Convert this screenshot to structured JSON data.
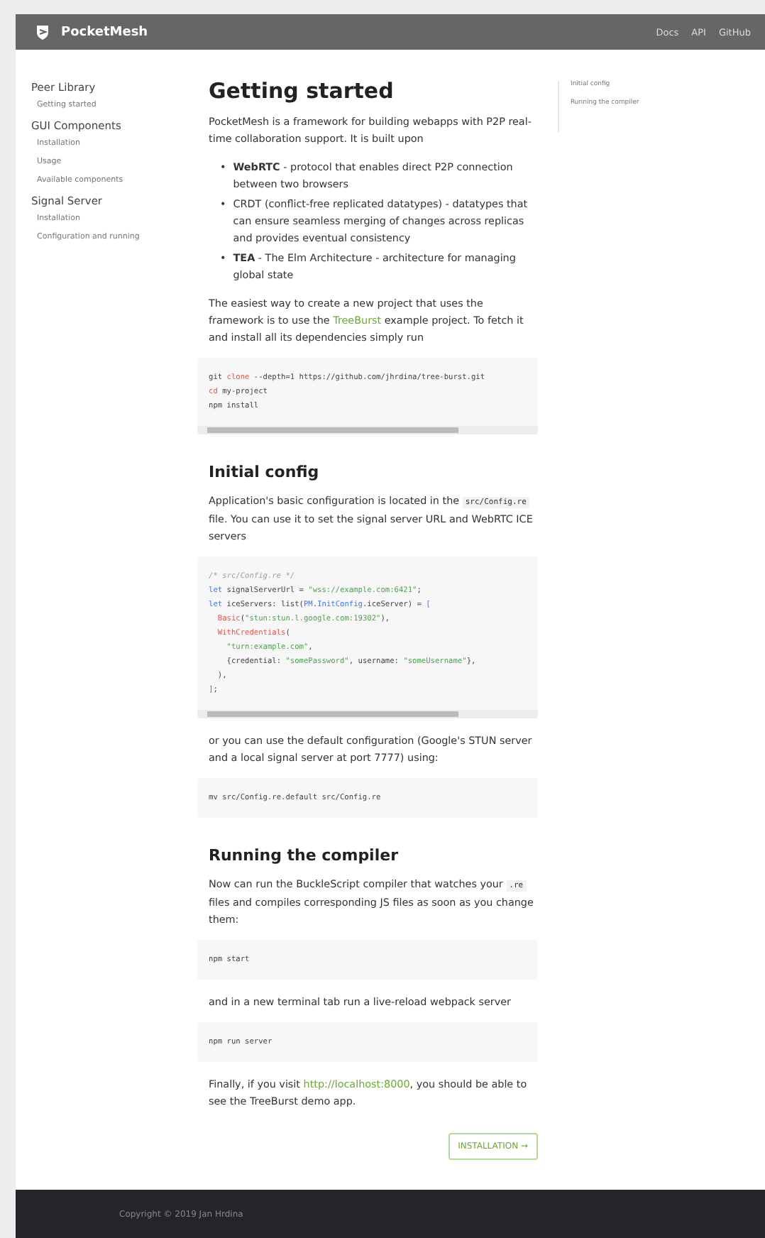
{
  "header": {
    "brand": "PocketMesh",
    "links": [
      "Docs",
      "API",
      "GitHub"
    ]
  },
  "sidebar": {
    "sections": [
      {
        "title": "Peer Library",
        "items": [
          "Getting started"
        ]
      },
      {
        "title": "GUI Components",
        "items": [
          "Installation",
          "Usage",
          "Available components"
        ]
      },
      {
        "title": "Signal Server",
        "items": [
          "Installation",
          "Configuration and running"
        ]
      }
    ]
  },
  "toc": [
    "Initial config",
    "Running the compiler"
  ],
  "content": [
    {
      "kind": "h1",
      "text": "Getting started"
    },
    {
      "kind": "p",
      "parts": [
        {
          "kind": "text",
          "text": "PocketMesh is a framework for building webapps with P2P real-time collaboration support. It is built upon"
        }
      ]
    },
    {
      "kind": "ul",
      "items": [
        {
          "marker": "•",
          "term": "WebRTC",
          "bold": true,
          "text": " - protocol that enables direct P2P connection between two browsers"
        },
        {
          "marker": "•",
          "term": "CRDT",
          "bold": false,
          "text": " (conflict-free replicated datatypes) - datatypes that can ensure seamless merging of changes across replicas and provides eventual consistency"
        },
        {
          "marker": "•",
          "term": "TEA",
          "bold": true,
          "text": " - The Elm Architecture - architecture for managing global state"
        }
      ]
    },
    {
      "kind": "p",
      "parts": [
        {
          "kind": "text",
          "text": "The easiest way to create a new project that uses the framework is to use the "
        },
        {
          "kind": "link",
          "text": "TreeBurst"
        },
        {
          "kind": "text",
          "text": " example project. To fetch it and install all its dependencies simply run"
        }
      ]
    },
    {
      "kind": "code",
      "scrollbar": true,
      "lines": [
        [
          {
            "kind": "plain",
            "text": "git "
          },
          {
            "kind": "keyword",
            "text": "clone"
          },
          {
            "kind": "plain",
            "text": " --depth=1 https://github.com/jhrdina/tree-burst.git"
          }
        ],
        [
          {
            "kind": "keyword",
            "text": "cd"
          },
          {
            "kind": "plain",
            "text": " my-project"
          }
        ],
        [
          {
            "kind": "plain",
            "text": "npm install"
          }
        ]
      ]
    },
    {
      "kind": "h2",
      "text": "Initial config"
    },
    {
      "kind": "p",
      "parts": [
        {
          "kind": "text",
          "text": "Application's basic configuration is located in the "
        },
        {
          "kind": "code",
          "text": "src/Config.re"
        },
        {
          "kind": "text",
          "text": " file. You can use it to set the signal server URL and WebRTC ICE servers"
        }
      ]
    },
    {
      "kind": "code",
      "scrollbar": true,
      "lines": [
        [
          {
            "kind": "comment",
            "text": "/* src/Config.re */"
          }
        ],
        [
          {
            "kind": "type",
            "text": "let"
          },
          {
            "kind": "plain",
            "text": " signalServerUrl = "
          },
          {
            "kind": "string",
            "text": "\"wss://example.com:6421\""
          },
          {
            "kind": "plain",
            "text": ";"
          }
        ],
        [
          {
            "kind": "type",
            "text": "let"
          },
          {
            "kind": "plain",
            "text": " iceServers: list("
          },
          {
            "kind": "type",
            "text": "PM"
          },
          {
            "kind": "plain",
            "text": "."
          },
          {
            "kind": "type",
            "text": "InitConfig"
          },
          {
            "kind": "plain",
            "text": ".iceServer) = "
          },
          {
            "kind": "type",
            "text": "["
          }
        ],
        [
          {
            "kind": "keyword",
            "text": "  Basic"
          },
          {
            "kind": "plain",
            "text": "("
          },
          {
            "kind": "string",
            "text": "\"stun:stun.l.google.com:19302\""
          },
          {
            "kind": "plain",
            "text": "),"
          }
        ],
        [
          {
            "kind": "keyword",
            "text": "  WithCredentials"
          },
          {
            "kind": "plain",
            "text": "("
          }
        ],
        [
          {
            "kind": "string",
            "text": "    \"turn:example.com\""
          },
          {
            "kind": "plain",
            "text": ","
          }
        ],
        [
          {
            "kind": "plain",
            "text": "    {credential: "
          },
          {
            "kind": "string",
            "text": "\"somePassword\""
          },
          {
            "kind": "plain",
            "text": ", username: "
          },
          {
            "kind": "string",
            "text": "\"someUsername\""
          },
          {
            "kind": "plain",
            "text": "},"
          }
        ],
        [
          {
            "kind": "plain",
            "text": "  ),"
          }
        ],
        [
          {
            "kind": "type",
            "text": "]"
          },
          {
            "kind": "plain",
            "text": ";"
          }
        ]
      ]
    },
    {
      "kind": "p",
      "parts": [
        {
          "kind": "text",
          "text": "or you can use the default configuration (Google's STUN server and a local signal server at port 7777) using:"
        }
      ]
    },
    {
      "kind": "code",
      "scrollbar": false,
      "lines": [
        [
          {
            "kind": "plain",
            "text": "mv src/Config.re.default src/Config.re"
          }
        ]
      ]
    },
    {
      "kind": "h2",
      "text": "Running the compiler"
    },
    {
      "kind": "p",
      "parts": [
        {
          "kind": "text",
          "text": "Now can run the BuckleScript compiler that watches your "
        },
        {
          "kind": "code",
          "text": ".re"
        },
        {
          "kind": "text",
          "text": " files and compiles corresponding JS files as soon as you change them:"
        }
      ]
    },
    {
      "kind": "code",
      "scrollbar": false,
      "lines": [
        [
          {
            "kind": "plain",
            "text": "npm start"
          }
        ]
      ]
    },
    {
      "kind": "p",
      "parts": [
        {
          "kind": "text",
          "text": "and in a new terminal tab run a live-reload webpack server"
        }
      ]
    },
    {
      "kind": "code",
      "scrollbar": false,
      "lines": [
        [
          {
            "kind": "plain",
            "text": "npm run server"
          }
        ]
      ]
    },
    {
      "kind": "p",
      "parts": [
        {
          "kind": "text",
          "text": "Finally, if you visit "
        },
        {
          "kind": "link",
          "text": "http://localhost:8000"
        },
        {
          "kind": "text",
          "text": ", you should be able to see the TreeBurst demo app."
        }
      ]
    }
  ],
  "next_button": "INSTALLATION →",
  "footer": "Copyright © 2019 Jan Hrdina"
}
